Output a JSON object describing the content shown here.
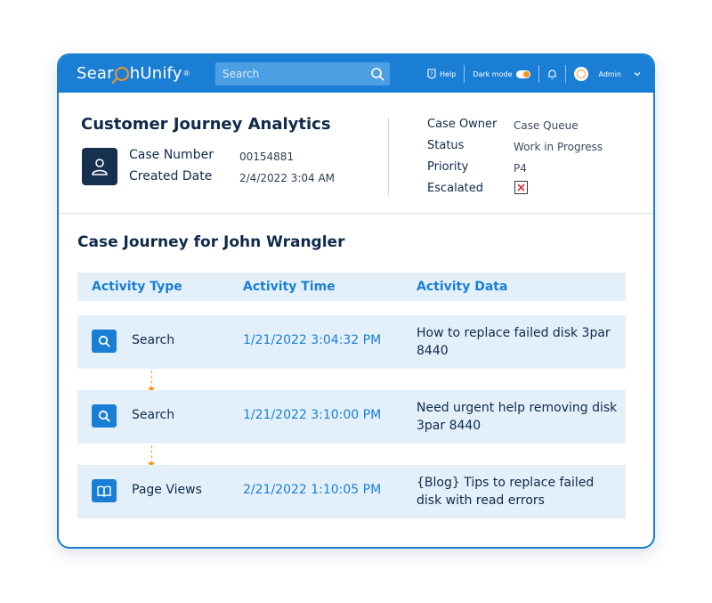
{
  "app": {
    "logo_pre": "Sear",
    "logo_post": "hUnify",
    "logo_tm": "®"
  },
  "topbar": {
    "search_placeholder": "Search",
    "help_label": "Help",
    "dark_mode_label": "Dark mode",
    "user_label": "Admin"
  },
  "case": {
    "title": "Customer Journey Analytics",
    "number_label": "Case Number",
    "number_value": "00154881",
    "created_label": "Created Date",
    "created_value": "2/4/2022 3:04 AM",
    "owner_label": "Case Owner",
    "owner_value": "Case Queue",
    "status_label": "Status",
    "status_value": "Work in Progress",
    "priority_label": "Priority",
    "priority_value": "P4",
    "escalated_label": "Escalated"
  },
  "journey": {
    "title": "Case Journey for John Wrangler",
    "columns": [
      "Activity Type",
      "Activity Time",
      "Activity Data"
    ],
    "rows": [
      {
        "icon": "search-icon",
        "type": "Search",
        "time": "1/21/2022  3:04:32 PM",
        "data": "How to replace failed disk 3par 8440"
      },
      {
        "icon": "search-icon",
        "type": "Search",
        "time": "1/21/2022  3:10:00 PM",
        "data": "Need urgent help removing disk 3par 8440"
      },
      {
        "icon": "book-icon",
        "type": "Page Views",
        "time": "2/21/2022  1:10:05 PM",
        "data": "{Blog} Tips to replace failed disk with read errors"
      }
    ]
  },
  "colors": {
    "primary": "#1a7fd4",
    "accent": "#f7941d",
    "dark": "#0f2a4a",
    "row_bg": "#e3f0fa"
  }
}
